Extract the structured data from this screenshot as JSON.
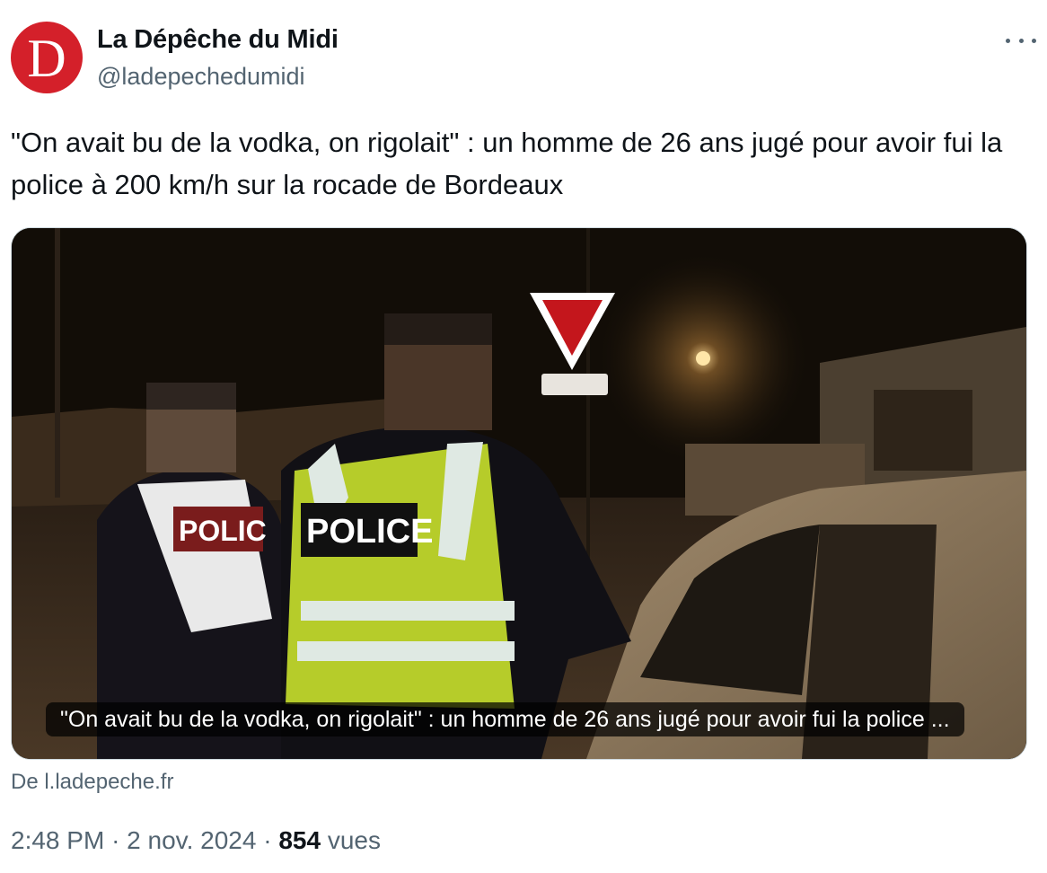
{
  "author": {
    "avatar_letter": "D",
    "name": "La Dépêche du Midi",
    "handle": "@ladepechedumidi"
  },
  "tweet": {
    "text": "\"On avait bu de la vodka, on rigolait\" : un homme de 26 ans jugé pour avoir fui la police à 200 km/h sur la rocade de Bordeaux"
  },
  "card": {
    "caption": "\"On avait bu de la vodka, on rigolait\" : un homme de 26 ans jugé pour avoir fui la police ...",
    "vest_left_label": "POLIC",
    "vest_right_label": "POLICE",
    "source": "De l.ladepeche.fr"
  },
  "meta": {
    "time": "2:48 PM",
    "separator": "·",
    "date": "2 nov. 2024",
    "views_count": "854",
    "views_label": "vues"
  },
  "colors": {
    "brand_red": "#d4202a",
    "text_primary": "#0f1419",
    "text_secondary": "#536471",
    "vest_yellow": "#b6cc2a"
  },
  "icons": {
    "more": "more-horizontal-icon"
  }
}
